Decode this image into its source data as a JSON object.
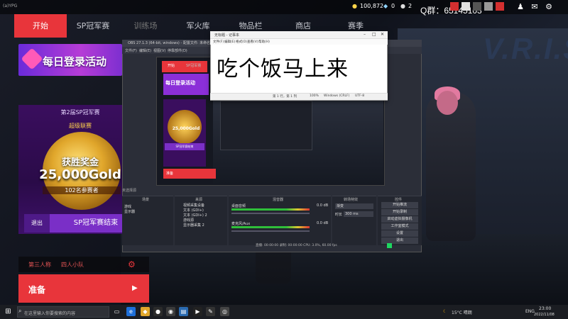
{
  "window_title": "(a)YPG",
  "currency": {
    "coins": "100,872",
    "gems": "0",
    "tickets": "2"
  },
  "qq_label": "Q群：65145103",
  "nav": {
    "items": [
      {
        "label": "开始",
        "active": true
      },
      {
        "label": "SP冠军赛",
        "active": false
      },
      {
        "label": "训练场",
        "active": false
      },
      {
        "label": "军火库",
        "active": false
      },
      {
        "label": "物品栏",
        "active": false
      },
      {
        "label": "商店",
        "active": false
      },
      {
        "label": "赛季",
        "active": false
      }
    ]
  },
  "banner": {
    "title": "每日登录活动"
  },
  "cup": {
    "title": "第2届SP冠军赛",
    "subtitle": "超级联赛",
    "prize_label": "获胜奖金",
    "prize_amount": "25,000Gold",
    "participants": "102名参赛者",
    "exit_label": "退出",
    "ended_label": "SP冠军赛结束"
  },
  "modes": {
    "trio": "第三人称",
    "squad": "四人小队"
  },
  "ready_label": "准备",
  "obs": {
    "title": "OBS 27.1.3 (64-bit, windows) - 配置文件: 未命名 - 场景: 未命名",
    "menu": [
      "文件(F)",
      "编辑(E)",
      "视图(V)",
      "停靠部件(D)",
      "配置文件(P)",
      "场景集合(S)",
      "工具(T)",
      "帮助(H)"
    ],
    "preview": {
      "start_label": "开始",
      "sp_label": "SP冠军赛",
      "banner": "每日登录活动",
      "gold": "25,000Gold",
      "ended": "SP冠军赛结束",
      "ready": "准备"
    },
    "no_source": "未选择源",
    "docks": {
      "scenes": "场景",
      "sources": "来源",
      "mixer": "混音器",
      "transitions": "转场特效",
      "controls": "控件"
    },
    "scenes": [
      "游戏",
      "显示器"
    ],
    "sources": [
      "视频采集设备",
      "文本 (GDI+)",
      "文本 (GDI+) 2",
      "游戏源",
      "显示器采集 2"
    ],
    "mixer": {
      "desktop": "桌面音频",
      "desktop_db": "0.0 dB",
      "mic": "麦克风/Aux",
      "mic_db": "0.0 dB"
    },
    "transition": {
      "fade": "渐变",
      "duration_label": "时长",
      "duration": "300 ms"
    },
    "controls": [
      "开始推流",
      "开始录制",
      "启动虚拟摄像机",
      "工作室模式",
      "设置",
      "退出"
    ],
    "status": "直播: 00:00:00   录制: 00:00:00   CPU: 3.0%, 60.00 fps"
  },
  "notepad": {
    "title": "无标题 - 记事本",
    "menu": [
      "文件(F)",
      "编辑(E)",
      "格式(O)",
      "查看(V)",
      "帮助(H)"
    ],
    "text": "吃个饭马上来",
    "status": [
      "第 1 行，第 1 列",
      "100%",
      "Windows (CRLF)",
      "UTF-8"
    ]
  },
  "taskbar": {
    "search_placeholder": "在这里输入你要搜索的内容",
    "weather": "15°C 晴朗",
    "lang": "ENG",
    "time": "23:00",
    "date": "2022/11/08"
  },
  "colors": {
    "accent_red": "#e8353b",
    "purple": "#7a2fc7",
    "gold": "#ffd54a"
  }
}
